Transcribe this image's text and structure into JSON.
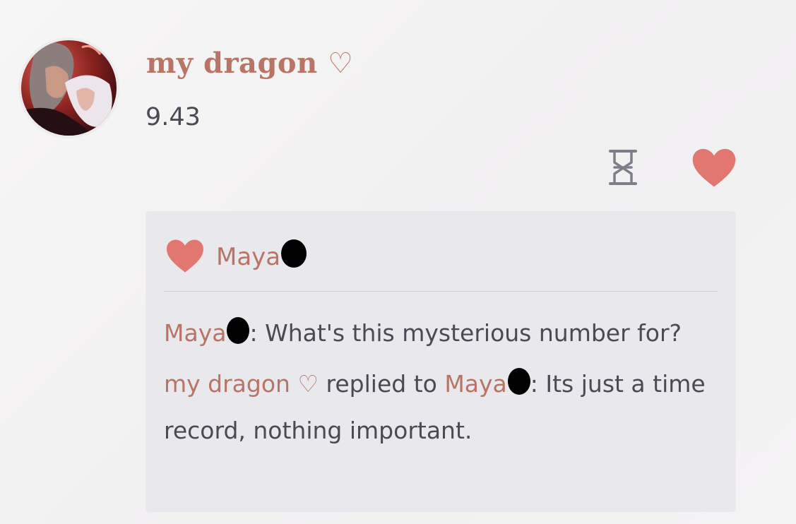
{
  "post": {
    "author_name": "my dragon ♡",
    "number": "9.43"
  },
  "icons": {
    "timer": "hourglass-icon",
    "like": "heart-icon"
  },
  "colors": {
    "accent": "#b87565",
    "heart": "#e27771",
    "text": "#4a4a55",
    "panel": "#e9e8ec"
  },
  "likes": {
    "names": [
      "Maya"
    ]
  },
  "comments": [
    {
      "author": "Maya",
      "separator": ": ",
      "text": "What's this mysterious number for?"
    },
    {
      "author": "my dragon ♡",
      "reply_label": " replied to ",
      "reply_to": "Maya",
      "separator": ": ",
      "text": "Its just a time record, nothing important."
    }
  ]
}
